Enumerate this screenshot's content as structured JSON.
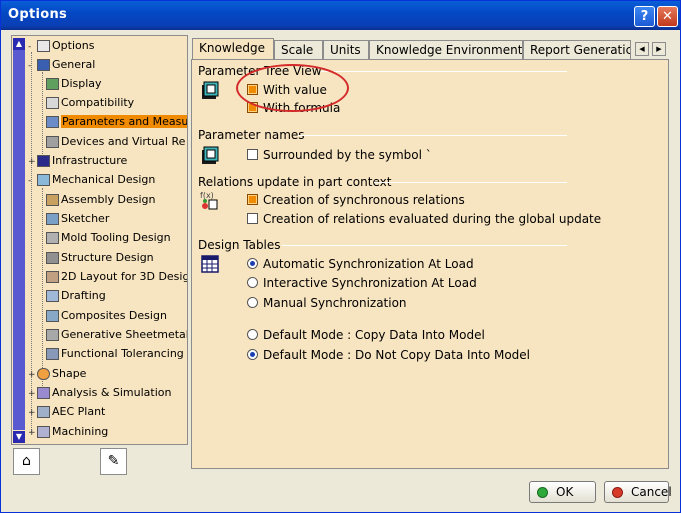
{
  "window": {
    "title": "Options",
    "help_label": "?",
    "close_label": "✕"
  },
  "tree": {
    "items": [
      {
        "label": "Options",
        "level": 0
      },
      {
        "label": "General",
        "level": 1
      },
      {
        "label": "Display",
        "level": 2
      },
      {
        "label": "Compatibility",
        "level": 2
      },
      {
        "label": "Parameters and Measu",
        "level": 2,
        "selected": true
      },
      {
        "label": "Devices and Virtual Re",
        "level": 2
      },
      {
        "label": "Infrastructure",
        "level": 1
      },
      {
        "label": "Mechanical Design",
        "level": 1
      },
      {
        "label": "Assembly Design",
        "level": 2
      },
      {
        "label": "Sketcher",
        "level": 2
      },
      {
        "label": "Mold Tooling Design",
        "level": 2
      },
      {
        "label": "Structure Design",
        "level": 2
      },
      {
        "label": "2D Layout for 3D Desig",
        "level": 2
      },
      {
        "label": "Drafting",
        "level": 2
      },
      {
        "label": "Composites Design",
        "level": 2
      },
      {
        "label": "Generative Sheetmetal",
        "level": 2
      },
      {
        "label": "Functional Tolerancing",
        "level": 2
      },
      {
        "label": "Shape",
        "level": 1
      },
      {
        "label": "Analysis & Simulation",
        "level": 1
      },
      {
        "label": "AEC Plant",
        "level": 1
      },
      {
        "label": "Machining",
        "level": 1
      }
    ]
  },
  "tabs": [
    {
      "label": "Knowledge",
      "active": true
    },
    {
      "label": "Scale"
    },
    {
      "label": "Units"
    },
    {
      "label": "Knowledge Environment"
    },
    {
      "label": "Report Generatic"
    }
  ],
  "sections": {
    "parameter_tree_view": {
      "title": "Parameter Tree View",
      "with_value": {
        "label": "With value",
        "checked": true
      },
      "with_formula": {
        "label": "With formula",
        "checked": true
      }
    },
    "parameter_names": {
      "title": "Parameter names",
      "surrounded": {
        "label": "Surrounded by the symbol `",
        "checked": false
      }
    },
    "relations_update": {
      "title": "Relations update in part context",
      "synchronous": {
        "label": "Creation of synchronous relations",
        "checked": true
      },
      "global_update": {
        "label": "Creation of relations evaluated during the global update",
        "checked": false
      }
    },
    "design_tables": {
      "title": "Design Tables",
      "auto_sync": {
        "label": "Automatic Synchronization At Load",
        "checked": true
      },
      "interactive_sync": {
        "label": "Interactive Synchronization At Load",
        "checked": false
      },
      "manual_sync": {
        "label": "Manual Synchronization",
        "checked": false
      },
      "copy_data": {
        "label": "Default Mode : Copy Data Into Model",
        "checked": false
      },
      "no_copy_data": {
        "label": "Default Mode : Do Not Copy Data Into Model",
        "checked": true
      }
    }
  },
  "footer": {
    "ok_label": "OK",
    "cancel_label": "Cancel"
  },
  "colors": {
    "title_bar": "#0348c4",
    "panel_bg": "#f7e4c0",
    "selection": "#f08a00",
    "annotation": "#d42a2a"
  }
}
